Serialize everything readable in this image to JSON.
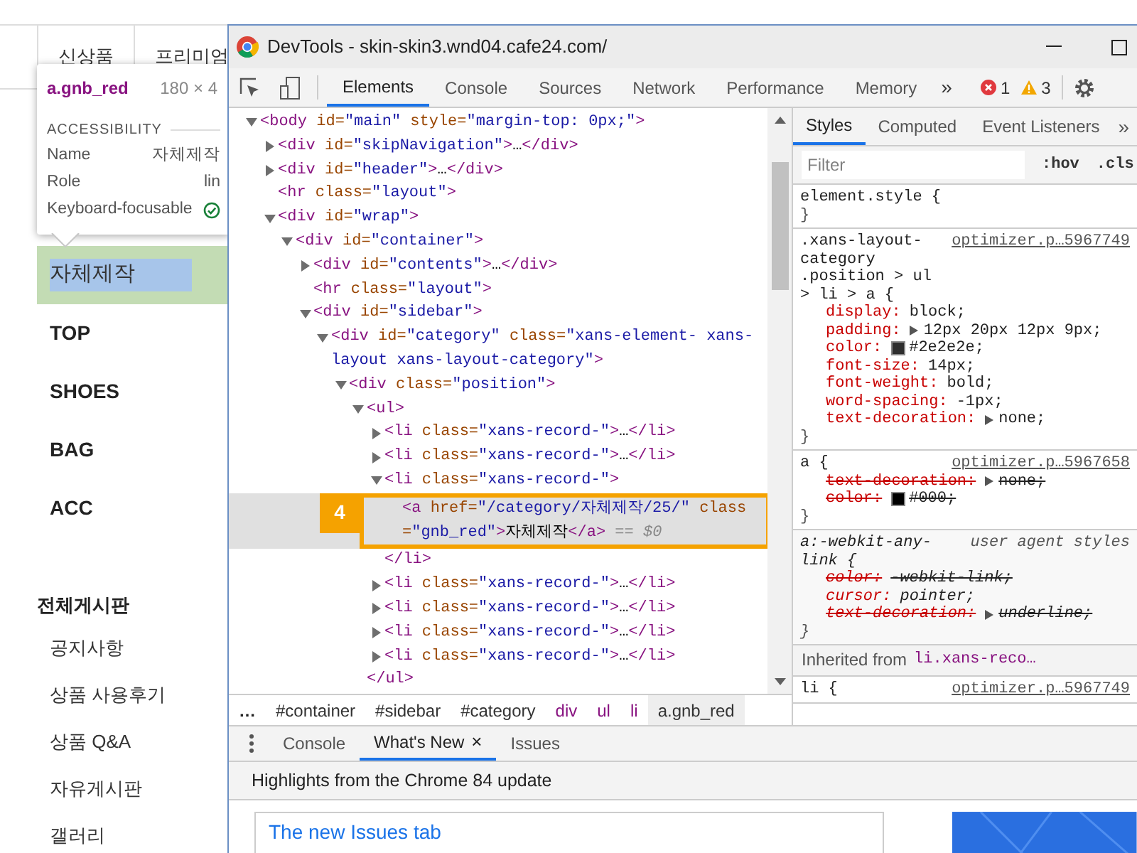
{
  "page": {
    "nav": [
      {
        "label": "신상품"
      },
      {
        "label": "프리미엄"
      }
    ],
    "categories": [
      {
        "label": "자체제작",
        "selected": true
      },
      {
        "label": "TOP",
        "selected": false
      },
      {
        "label": "SHOES",
        "selected": false
      },
      {
        "label": "BAG",
        "selected": false
      },
      {
        "label": "ACC",
        "selected": false
      }
    ],
    "board_title": "전체게시판",
    "boards": [
      "공지사항",
      "상품 사용후기",
      "상품 Q&A",
      "자유게시판",
      "갤러리"
    ]
  },
  "tooltip": {
    "selector": "a.gnb_red",
    "size": "180 × 4",
    "section": "ACCESSIBILITY",
    "rows": [
      {
        "label": "Name",
        "value": "자체제작"
      },
      {
        "label": "Role",
        "value": "lin"
      },
      {
        "label": "Keyboard-focusable",
        "checked": true
      }
    ]
  },
  "devtools": {
    "title": "DevTools - skin-skin3.wnd04.cafe24.com/",
    "tabs": [
      {
        "label": "Elements",
        "selected": true
      },
      {
        "label": "Console",
        "selected": false
      },
      {
        "label": "Sources",
        "selected": false
      },
      {
        "label": "Network",
        "selected": false
      },
      {
        "label": "Performance",
        "selected": false
      },
      {
        "label": "Memory",
        "selected": false
      }
    ],
    "tabs_more": "»",
    "errors": "1",
    "warnings": "3",
    "dom": [
      {
        "markup": "<body id=\"main\" style=\"margin-top: 0px;\">",
        "expanded": true,
        "selected": false,
        "children": [
          {
            "markup": "<div id=\"skipNavigation\">…</div>",
            "expanded": false,
            "selected": false
          },
          {
            "markup": "<div id=\"header\">…</div>",
            "expanded": false,
            "selected": false
          },
          {
            "markup": "<hr class=\"layout\">",
            "selected": false
          },
          {
            "markup": "<div id=\"wrap\">",
            "expanded": true,
            "selected": false,
            "children": [
              {
                "markup": "<div id=\"container\">",
                "expanded": true,
                "selected": false,
                "children": [
                  {
                    "markup": "<div id=\"contents\">…</div>",
                    "expanded": false,
                    "selected": false
                  },
                  {
                    "markup": "<hr class=\"layout\">",
                    "selected": false
                  },
                  {
                    "markup": "<div id=\"sidebar\">",
                    "expanded": true,
                    "selected": false,
                    "children": [
                      {
                        "markup": "<div id=\"category\" class=\"xans-element- xans-layout xans-layout-category\">",
                        "expanded": true,
                        "selected": false,
                        "children": [
                          {
                            "markup": "<div class=\"position\">",
                            "expanded": true,
                            "selected": false,
                            "children": [
                              {
                                "markup": "<ul>",
                                "expanded": true,
                                "selected": false,
                                "close": "</ul>",
                                "children": [
                                  {
                                    "markup": "<li class=\"xans-record-\">…</li>",
                                    "expanded": false,
                                    "selected": false
                                  },
                                  {
                                    "markup": "<li class=\"xans-record-\">…</li>",
                                    "expanded": false,
                                    "selected": false
                                  },
                                  {
                                    "markup": "<li class=\"xans-record-\">",
                                    "expanded": true,
                                    "selected": false,
                                    "close": "</li>",
                                    "children": [
                                      {
                                        "markup": "<a href=\"/category/자체제작/25/\" class=\"gnb_red\">자체제작</a>",
                                        "suffix": "== $0",
                                        "selected": true,
                                        "annotation": "4"
                                      }
                                    ]
                                  },
                                  {
                                    "markup": "<li class=\"xans-record-\">…</li>",
                                    "expanded": false,
                                    "selected": false
                                  },
                                  {
                                    "markup": "<li class=\"xans-record-\">…</li>",
                                    "expanded": false,
                                    "selected": false
                                  },
                                  {
                                    "markup": "<li class=\"xans-record-\">…</li>",
                                    "expanded": false,
                                    "selected": false
                                  },
                                  {
                                    "markup": "<li class=\"xans-record-\">…</li>",
                                    "expanded": false,
                                    "selected": false
                                  }
                                ]
                              }
                            ]
                          }
                        ]
                      }
                    ]
                  }
                ]
              }
            ]
          }
        ]
      }
    ],
    "breadcrumbs": [
      {
        "label": "…",
        "kind": "more",
        "selected": false
      },
      {
        "label": "#container",
        "kind": "id",
        "selected": false
      },
      {
        "label": "#sidebar",
        "kind": "id",
        "selected": false
      },
      {
        "label": "#category",
        "kind": "id",
        "selected": false
      },
      {
        "label": "div",
        "kind": "tag",
        "selected": false
      },
      {
        "label": "ul",
        "kind": "tag",
        "selected": false
      },
      {
        "label": "li",
        "kind": "tag",
        "selected": false
      },
      {
        "label": "a.gnb_red",
        "kind": "id",
        "selected": true
      }
    ],
    "styles": {
      "tabs": [
        {
          "label": "Styles",
          "selected": true
        },
        {
          "label": "Computed",
          "selected": false
        },
        {
          "label": "Event Listeners",
          "selected": false
        }
      ],
      "tabs_more": "»",
      "filter": {
        "placeholder": "Filter"
      },
      "buttons": [
        ":hov",
        ".cls"
      ],
      "rules": [
        {
          "selector": "element.style {",
          "kind": "author",
          "close": "}"
        },
        {
          "selector": ".xans-layout-category .position > ul > li > a {",
          "source": "optimizer.p…5967749",
          "kind": "author",
          "close": "}",
          "props": [
            {
              "name": "display:",
              "value": "block;",
              "struck": false,
              "expandable": false
            },
            {
              "name": "padding:",
              "value": "12px 20px 12px 9px;",
              "struck": false,
              "expandable": true
            },
            {
              "name": "color:",
              "value": "#2e2e2e;",
              "struck": false,
              "expandable": false,
              "color": "#2e2e2e"
            },
            {
              "name": "font-size:",
              "value": "14px;",
              "struck": false,
              "expandable": false
            },
            {
              "name": "font-weight:",
              "value": "bold;",
              "struck": false,
              "expandable": false
            },
            {
              "name": "word-spacing:",
              "value": "-1px;",
              "struck": false,
              "expandable": false
            },
            {
              "name": "text-decoration:",
              "value": "none;",
              "struck": false,
              "expandable": true
            }
          ]
        },
        {
          "selector": "a {",
          "source": "optimizer.p…5967658",
          "kind": "author",
          "close": "}",
          "props": [
            {
              "name": "text-decoration:",
              "value": "none;",
              "struck": true,
              "expandable": true
            },
            {
              "name": "color:",
              "value": "#000;",
              "struck": true,
              "expandable": false,
              "color": "#000000"
            }
          ]
        },
        {
          "selector": "a:-webkit-any-link {",
          "source": "user agent styles",
          "kind": "user-agent",
          "close": "}",
          "props": [
            {
              "name": "color:",
              "value": "-webkit-link;",
              "struck": true,
              "expandable": false
            },
            {
              "name": "cursor:",
              "value": "pointer;",
              "struck": false,
              "expandable": false
            },
            {
              "name": "text-decoration:",
              "value": "underline;",
              "struck": true,
              "expandable": true
            }
          ]
        },
        {
          "kind": "inherited",
          "label": "Inherited from",
          "selector": "li.xans-reco…"
        },
        {
          "selector": "li {",
          "source": "optimizer.p…5967749",
          "kind": "author"
        }
      ]
    },
    "drawer": {
      "tabs": [
        {
          "label": "Console",
          "selected": false,
          "closable": false
        },
        {
          "label": "What's New",
          "selected": true,
          "closable": true,
          "close": "×"
        },
        {
          "label": "Issues",
          "selected": false,
          "closable": false
        }
      ],
      "heading": "Highlights from the Chrome 84 update",
      "card_title": "The new Issues tab"
    }
  }
}
